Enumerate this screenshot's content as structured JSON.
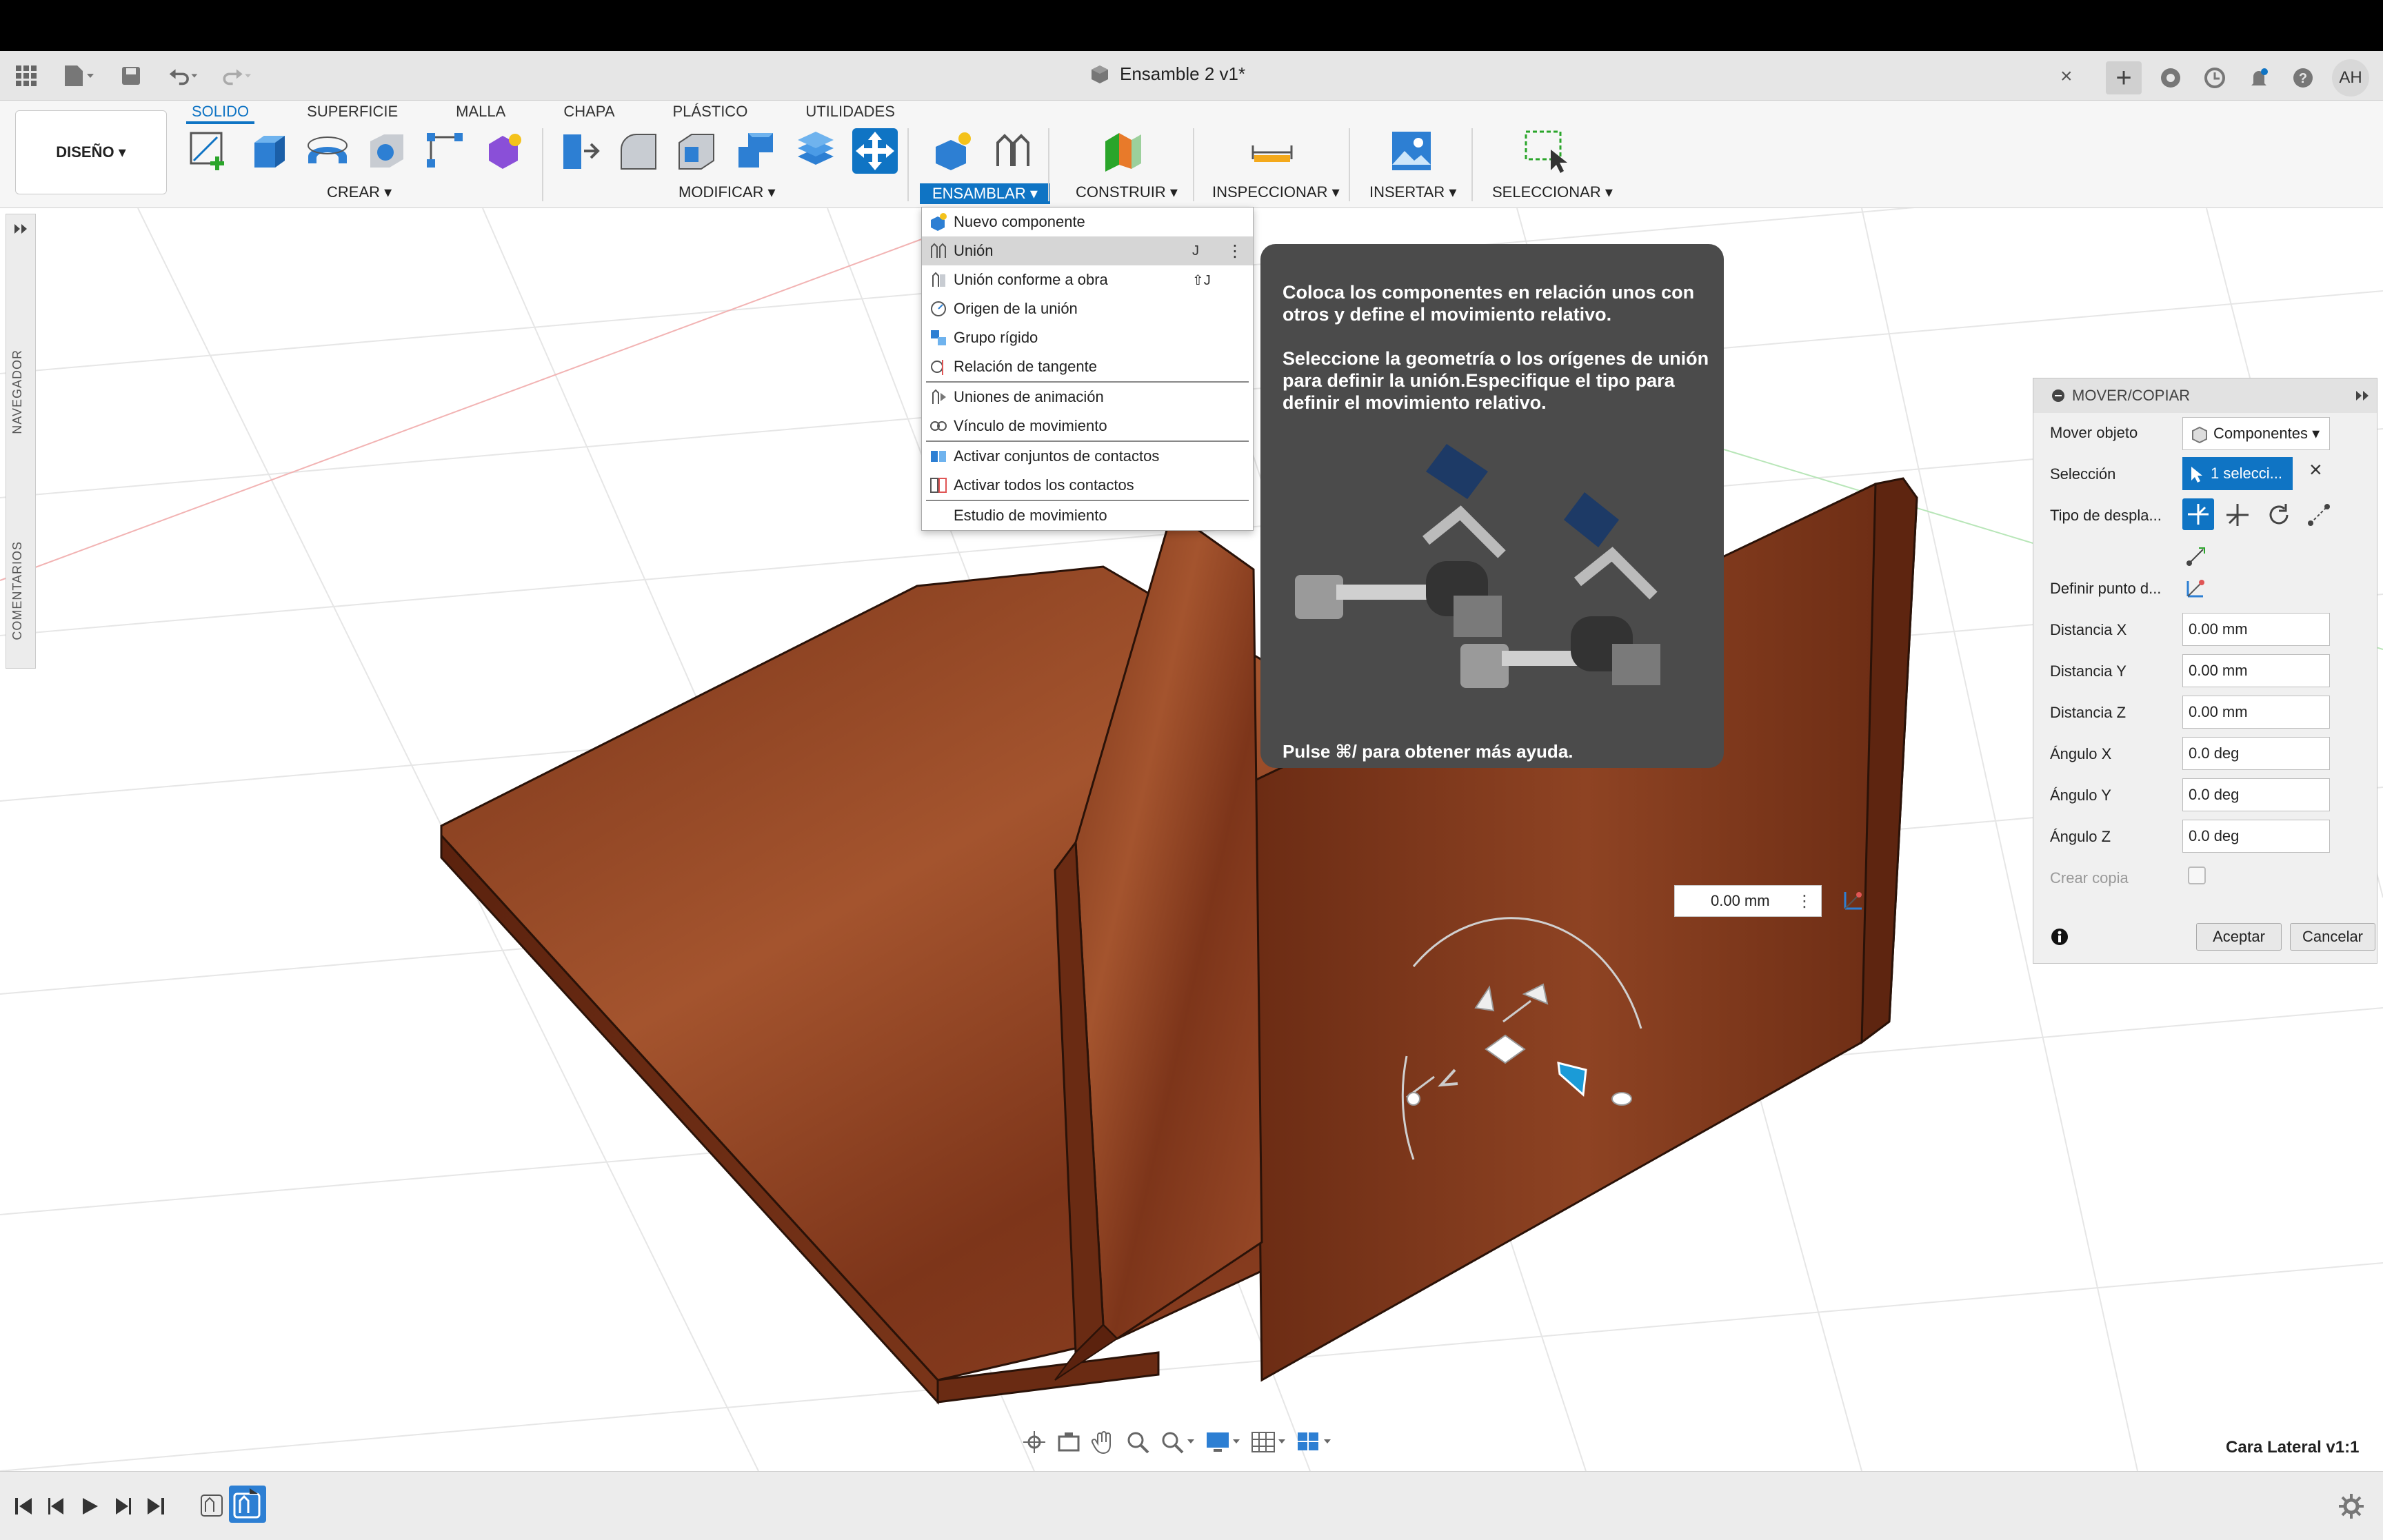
{
  "window": {
    "title": "Ensamble 2 v1*",
    "close_symbol": "×",
    "add_tab_symbol": "+",
    "user_initials": "AH"
  },
  "workspace": {
    "mode_label": "DISEÑO ▾"
  },
  "ribbon": {
    "tabs": [
      "SOLIDO",
      "SUPERFICIE",
      "MALLA",
      "CHAPA",
      "PLÁSTICO",
      "UTILIDADES"
    ],
    "active_tab": "SOLIDO",
    "groups": {
      "crear": "CREAR ▾",
      "modificar": "MODIFICAR ▾",
      "ensamblar": "ENSAMBLAR ▾",
      "construir": "CONSTRUIR ▾",
      "inspeccionar": "INSPECCIONAR ▾",
      "insertar": "INSERTAR ▾",
      "seleccionar": "SELECCIONAR ▾"
    }
  },
  "left_panel": {
    "navegador": "NAVEGADOR",
    "comentarios": "COMENTARIOS"
  },
  "assemble_menu": {
    "items": [
      {
        "label": "Nuevo componente",
        "shortcut": ""
      },
      {
        "label": "Unión",
        "shortcut": "J"
      },
      {
        "label": "Unión conforme a obra",
        "shortcut": "⇧J"
      },
      {
        "label": "Origen de la unión",
        "shortcut": ""
      },
      {
        "label": "Grupo rígido",
        "shortcut": ""
      },
      {
        "label": "Relación de tangente",
        "shortcut": ""
      },
      {
        "label": "Uniones de animación",
        "shortcut": ""
      },
      {
        "label": "Vínculo de movimiento",
        "shortcut": ""
      },
      {
        "label": "Activar conjuntos de contactos",
        "shortcut": ""
      },
      {
        "label": "Activar todos los contactos",
        "shortcut": ""
      },
      {
        "label": "Estudio de movimiento",
        "shortcut": ""
      }
    ],
    "more_symbol": "⋮"
  },
  "tooltip": {
    "line1": "Coloca los componentes en relación unos con otros y define el movimiento relativo.",
    "line2": "Seleccione la geometría o los orígenes de unión para definir la unión.Especifique el tipo para definir el movimiento relativo.",
    "footer": "Pulse ⌘/ para obtener más ayuda."
  },
  "move_dialog": {
    "title": "MOVER/COPIAR",
    "rows": {
      "mover_objeto": {
        "label": "Mover objeto",
        "value": "Componentes ▾"
      },
      "seleccion": {
        "label": "Selección",
        "value": "1 selecci..."
      },
      "tipo": {
        "label": "Tipo de despla..."
      },
      "definir": {
        "label": "Definir punto d..."
      },
      "dx": {
        "label": "Distancia X",
        "value": "0.00 mm"
      },
      "dy": {
        "label": "Distancia Y",
        "value": "0.00 mm"
      },
      "dz": {
        "label": "Distancia Z",
        "value": "0.00 mm"
      },
      "ax": {
        "label": "Ángulo X",
        "value": "0.0 deg"
      },
      "ay": {
        "label": "Ángulo Y",
        "value": "0.0 deg"
      },
      "az": {
        "label": "Ángulo Z",
        "value": "0.0 deg"
      },
      "copia": {
        "label": "Crear copia"
      }
    },
    "ok": "Aceptar",
    "cancel": "Cancelar",
    "clear_symbol": "×"
  },
  "inline_input": {
    "value": "0.00 mm"
  },
  "status": {
    "component": "Cara Lateral v1:1"
  },
  "colors": {
    "accent": "#0f74c4",
    "wood": "#8b3e22",
    "tooltip_bg": "#4b4b4b"
  }
}
